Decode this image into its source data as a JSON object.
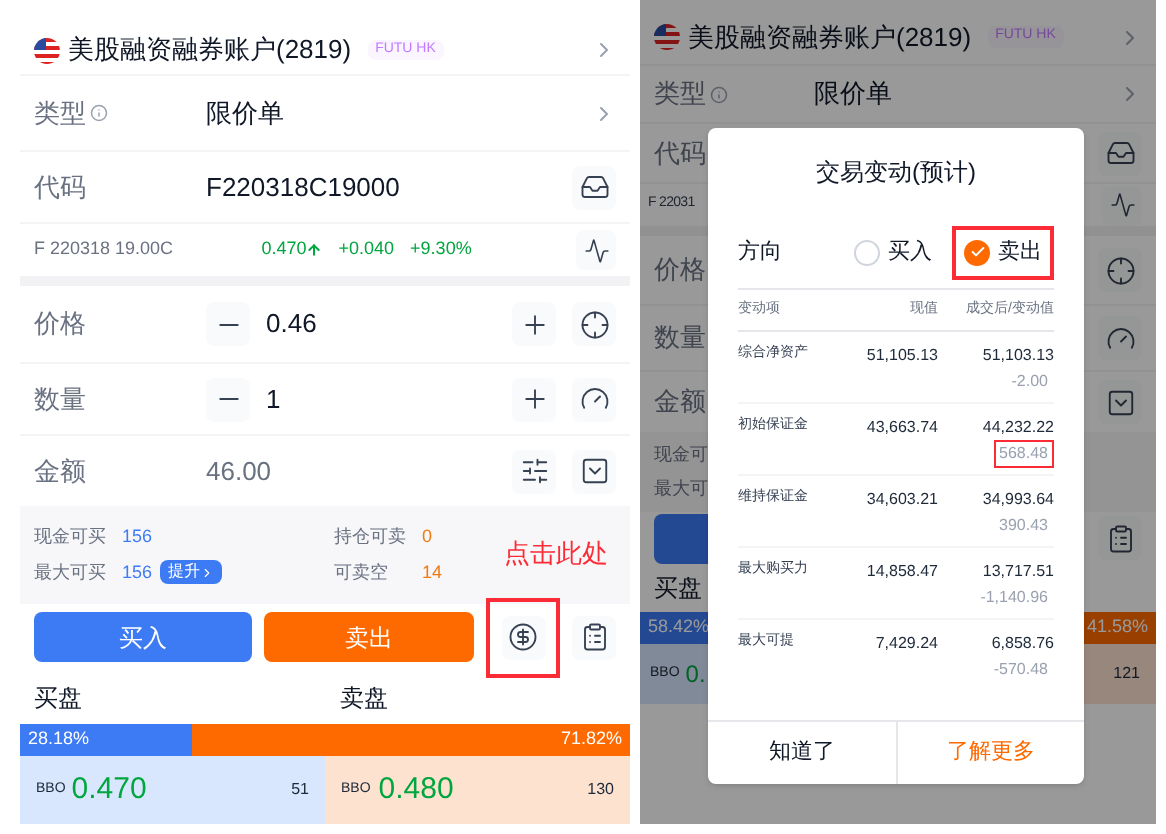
{
  "left": {
    "account": {
      "name": "美股融资融券账户(2819)",
      "badge": "FUTU HK"
    },
    "order_type": {
      "label": "类型",
      "value": "限价单"
    },
    "code": {
      "label": "代码",
      "value": "F220318C19000"
    },
    "quote": {
      "name": "F 220318 19.00C",
      "price": "0.470",
      "change": "+0.040",
      "change_pct": "+9.30%"
    },
    "price": {
      "label": "价格",
      "value": "0.46"
    },
    "quantity": {
      "label": "数量",
      "value": "1"
    },
    "amount": {
      "label": "金额",
      "value": "46.00"
    },
    "stats": [
      {
        "label": "现金可买",
        "value": "156",
        "color": "#3d7bf5"
      },
      {
        "label": "持仓可卖",
        "value": "0",
        "color": "#f07a12"
      },
      {
        "label": "最大可买",
        "value": "156",
        "color": "#3d7bf5",
        "action": "提升"
      },
      {
        "label": "可卖空",
        "value": "14",
        "color": "#f07a12"
      }
    ],
    "annotation": "点击此处",
    "buy_button": "买入",
    "sell_button": "卖出",
    "fx_highlighted": true,
    "bid_label": "买盘",
    "ask_label": "卖盘",
    "ratio": {
      "bid": "28.18%",
      "ask": "71.82%",
      "level": 0.2818
    },
    "bbo": {
      "bid": {
        "label": "BBO",
        "price": "0.470",
        "size": "51"
      },
      "ask": {
        "label": "BBO",
        "price": "0.480",
        "size": "130"
      }
    }
  },
  "right": {
    "account": {
      "name": "美股融资融券账户(2819)",
      "badge": "FUTU HK"
    },
    "order_type": {
      "label": "类型",
      "value": "限价单"
    },
    "code": {
      "label": "代码"
    },
    "quote": {
      "name": "F 22031"
    },
    "price": {
      "label": "价格"
    },
    "quantity": {
      "label": "数量"
    },
    "amount": {
      "label": "金额"
    },
    "stats": [
      {
        "label": "现金可"
      },
      {
        "label": "最大可"
      }
    ],
    "bid_label": "买盘",
    "ratio": {
      "bid": "58.42%",
      "ask": "41.58%",
      "level": 0.5842
    },
    "bbo": {
      "bid": {
        "label": "BBO",
        "price": "0."
      },
      "ask": {
        "size": "121"
      }
    },
    "modal": {
      "title": "交易变动(预计)",
      "direction_label": "方向",
      "options": [
        {
          "label": "买入",
          "selected": false,
          "highlighted": false
        },
        {
          "label": "卖出",
          "selected": true,
          "highlighted": true
        }
      ],
      "columns": [
        "变动项",
        "现值",
        "成交后/变动值"
      ],
      "rows": [
        {
          "item": "综合净资产",
          "current": "51,105.13",
          "after": "51,103.13",
          "change": "-2.00",
          "highlighted": false
        },
        {
          "item": "初始保证金",
          "current": "43,663.74",
          "after": "44,232.22",
          "change": "568.48",
          "highlighted": true
        },
        {
          "item": "维持保证金",
          "current": "34,603.21",
          "after": "34,993.64",
          "change": "390.43",
          "highlighted": false
        },
        {
          "item": "最大购买力",
          "current": "14,858.47",
          "after": "13,717.51",
          "change": "-1,140.96",
          "highlighted": false
        },
        {
          "item": "最大可提",
          "current": "7,429.24",
          "after": "6,858.76",
          "change": "-570.48",
          "highlighted": false
        }
      ],
      "buttons": [
        {
          "label": "知道了",
          "kind": "plain"
        },
        {
          "label": "了解更多",
          "kind": "primary"
        }
      ]
    }
  }
}
